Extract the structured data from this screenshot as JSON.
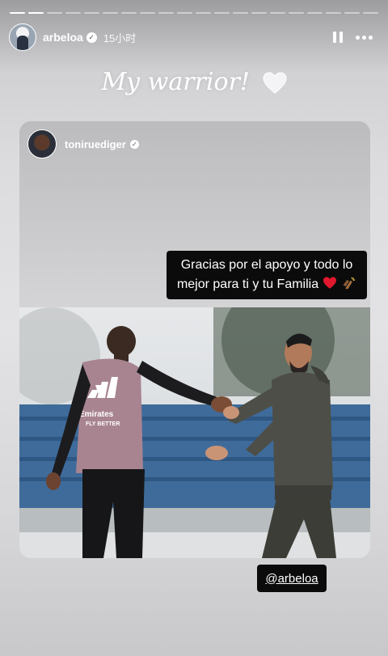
{
  "story": {
    "progress_segments": 20,
    "progress_done": 2,
    "user": {
      "username": "arbeloa",
      "verified": true,
      "time": "15小时"
    },
    "controls": {
      "pause_icon": "pause-icon",
      "more_icon": "more-icon"
    },
    "caption": {
      "text": "My warrior!",
      "emoji": "white-heart-icon"
    }
  },
  "reshared_post": {
    "username": "toniruediger",
    "verified": true,
    "message_line1": "Gracias por el apoyo y todo lo",
    "message_line2": "mejor para ti y tu Familia",
    "message_emojis": [
      "red-heart-icon",
      "clapping-hands-icon"
    ],
    "photo": {
      "description_icon": "photo",
      "jersey_sponsor_line1": "Emirates",
      "jersey_sponsor_line2": "FLY BETTER"
    }
  },
  "mention_sticker": {
    "text": "@arbeloa"
  },
  "colors": {
    "accent_heart": "#e0192e",
    "sticker_bg": "#0b0b0b"
  }
}
